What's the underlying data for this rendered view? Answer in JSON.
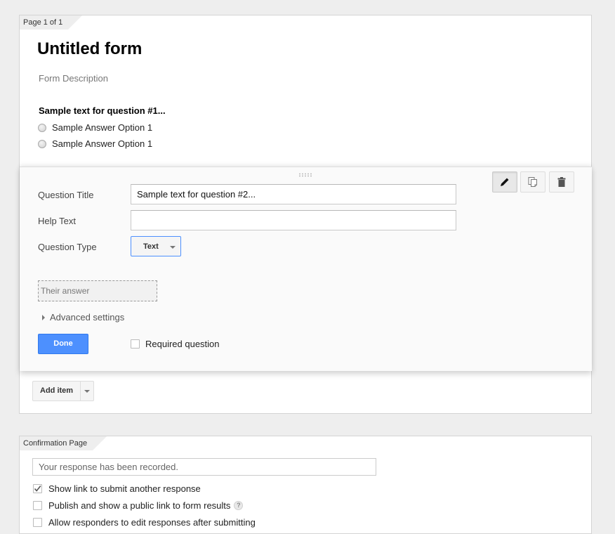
{
  "form": {
    "page_tab": "Page 1 of 1",
    "title": "Untitled form",
    "description_placeholder": "Form Description"
  },
  "question1": {
    "title": "Sample text for question #1...",
    "options": [
      "Sample Answer Option 1",
      "Sample Answer Option 1"
    ]
  },
  "edit_panel": {
    "tools": [
      {
        "icon": "pencil-icon",
        "label": "Edit",
        "active": true
      },
      {
        "icon": "duplicate-icon",
        "label": "Duplicate",
        "active": false
      },
      {
        "icon": "trash-icon",
        "label": "Delete",
        "active": false
      }
    ],
    "question_title_label": "Question Title",
    "question_title_value": "Sample text for question #2...",
    "help_text_label": "Help Text",
    "help_text_value": "",
    "question_type_label": "Question Type",
    "question_type_value": "Text",
    "answer_preview": "Their answer",
    "advanced_settings": "Advanced settings",
    "done_label": "Done",
    "required_label": "Required question",
    "required_checked": false
  },
  "add_item": {
    "label": "Add item"
  },
  "confirmation": {
    "page_tab": "Confirmation Page",
    "message": "Your response has been recorded.",
    "options": [
      {
        "label": "Show link to submit another response",
        "checked": true
      },
      {
        "label": "Publish and show a public link to form results",
        "checked": false,
        "help": "?"
      },
      {
        "label": "Allow responders to edit responses after submitting",
        "checked": false
      }
    ]
  },
  "colors": {
    "primary_blue": "#4d90fe",
    "background": "#eeeeee"
  }
}
